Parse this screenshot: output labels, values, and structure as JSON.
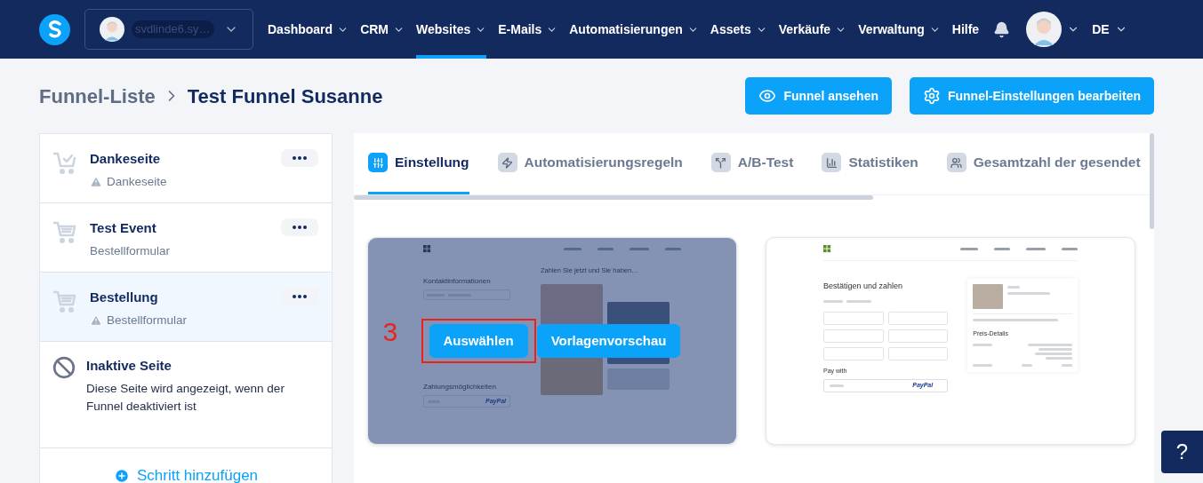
{
  "nav": {
    "account": "svdlinde6.sy…",
    "items": [
      {
        "label": "Dashboard",
        "dropdown": true,
        "selected": false
      },
      {
        "label": "CRM",
        "dropdown": true,
        "selected": false
      },
      {
        "label": "Websites",
        "dropdown": true,
        "selected": true
      },
      {
        "label": "E-Mails",
        "dropdown": true,
        "selected": false
      },
      {
        "label": "Automatisierungen",
        "dropdown": true,
        "selected": false
      },
      {
        "label": "Assets",
        "dropdown": true,
        "selected": false
      },
      {
        "label": "Verkäufe",
        "dropdown": true,
        "selected": false
      },
      {
        "label": "Verwaltung",
        "dropdown": true,
        "selected": false
      },
      {
        "label": "Hilfe",
        "dropdown": false,
        "selected": false
      }
    ],
    "language": "DE"
  },
  "breadcrumb": [
    "Funnel-Liste",
    "Test Funnel Susanne"
  ],
  "header_buttons": [
    {
      "label": "Funnel ansehen",
      "kind": "eye"
    },
    {
      "label": "Funnel-Einstellungen bearbeiten",
      "kind": "gear"
    }
  ],
  "steps": [
    {
      "title": "Dankeseite",
      "subtitle": "Dankeseite",
      "kind": "thanks",
      "warning": true,
      "selected": false
    },
    {
      "title": "Test Event",
      "subtitle": "Bestellformular",
      "kind": "order",
      "warning": false,
      "selected": false
    },
    {
      "title": "Bestellung",
      "subtitle": "Bestellformular",
      "kind": "order",
      "warning": true,
      "selected": true
    }
  ],
  "inactive_page": {
    "title": "Inaktive Seite",
    "description": "Diese Seite wird angezeigt, wenn der Funnel deaktiviert ist"
  },
  "add_step": "Schritt hinzufügen",
  "tabs": [
    {
      "label": "Einstellung",
      "kind": "settings",
      "selected": true
    },
    {
      "label": "Automatisierungsregeln",
      "kind": "bolt",
      "selected": false
    },
    {
      "label": "A/B-Test",
      "kind": "split",
      "selected": false
    },
    {
      "label": "Statistiken",
      "kind": "stats",
      "selected": false
    },
    {
      "label": "Gesamtzahl der gesendet",
      "kind": "people",
      "selected": false
    }
  ],
  "templates": [
    {
      "kind": "contact",
      "hovered": true,
      "heading": "Kontaktinformationen",
      "payment_heading": "Zahlungsmöglichkeiten",
      "payment_logo": "PayPal",
      "gallery_heading": "Zahlen Sie jetzt und Sie haben…",
      "actions": [
        {
          "label": "Auswählen",
          "annotated": true
        },
        {
          "label": "Vorlagenvorschau",
          "annotated": false
        }
      ]
    },
    {
      "kind": "checkout",
      "hovered": false,
      "heading": "Bestätigen und zahlen",
      "payment_heading": "Pay with",
      "payment_logo": "PayPal",
      "price_heading": "Preis-Details"
    }
  ],
  "annotation": "3",
  "help": "?"
}
